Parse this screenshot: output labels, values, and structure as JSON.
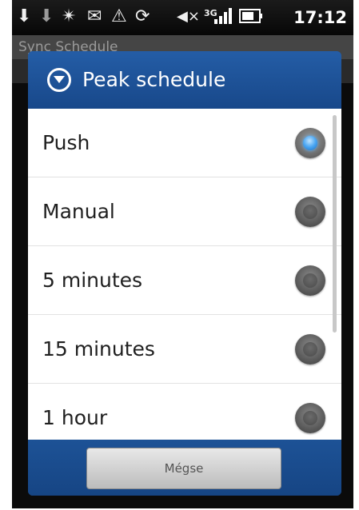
{
  "status_bar": {
    "time": "17:12",
    "network_type": "3G",
    "icons": [
      "download-icon",
      "download-icon",
      "sync-star-icon",
      "mail-icon",
      "warning-icon",
      "sync-disabled-icon",
      "mute-icon",
      "signal-icon",
      "battery-icon"
    ]
  },
  "background": {
    "title": "Sync Schedule"
  },
  "dialog": {
    "title": "Peak schedule",
    "options": [
      {
        "label": "Push",
        "selected": true
      },
      {
        "label": "Manual",
        "selected": false
      },
      {
        "label": "5 minutes",
        "selected": false
      },
      {
        "label": "15 minutes",
        "selected": false
      },
      {
        "label": "1 hour",
        "selected": false
      }
    ],
    "cancel_label": "Mégse"
  },
  "colors": {
    "dialog_blue": "#1a4d8f",
    "selected_radio": "#4aa6f2"
  }
}
